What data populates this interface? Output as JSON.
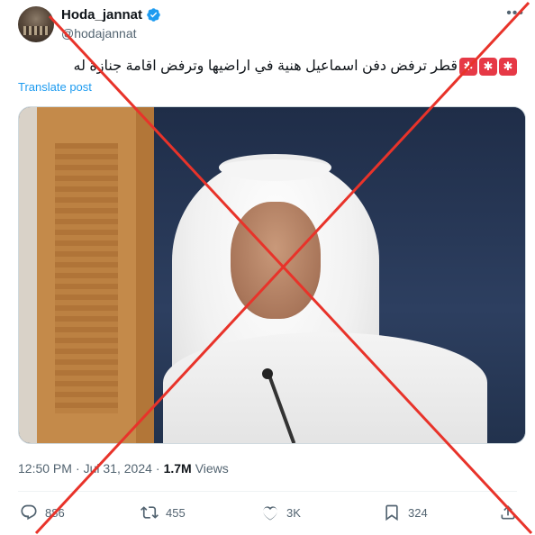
{
  "user": {
    "display_name": "Hoda_jannat",
    "handle": "@hodajannat",
    "verified": true
  },
  "more_icon": "ellipsis-icon",
  "tweet": {
    "text": "قطر ترفض دفن اسماعيل هنية في اراضيها وترفض اقامة جنازة له",
    "leading_emoji": [
      "police-light-icon",
      "police-light-icon",
      "police-light-icon"
    ],
    "translate_label": "Translate post"
  },
  "meta": {
    "time": "12:50 PM",
    "separator1": "·",
    "date": "Jul 31, 2024",
    "separator2": "·",
    "views_count": "1.7M",
    "views_label": "Views"
  },
  "actions": {
    "replies": "886",
    "retweets": "455",
    "likes": "3K",
    "bookmarks": "324"
  },
  "overlay": {
    "color": "#e8332a",
    "type": "red-x-cross-icon"
  }
}
